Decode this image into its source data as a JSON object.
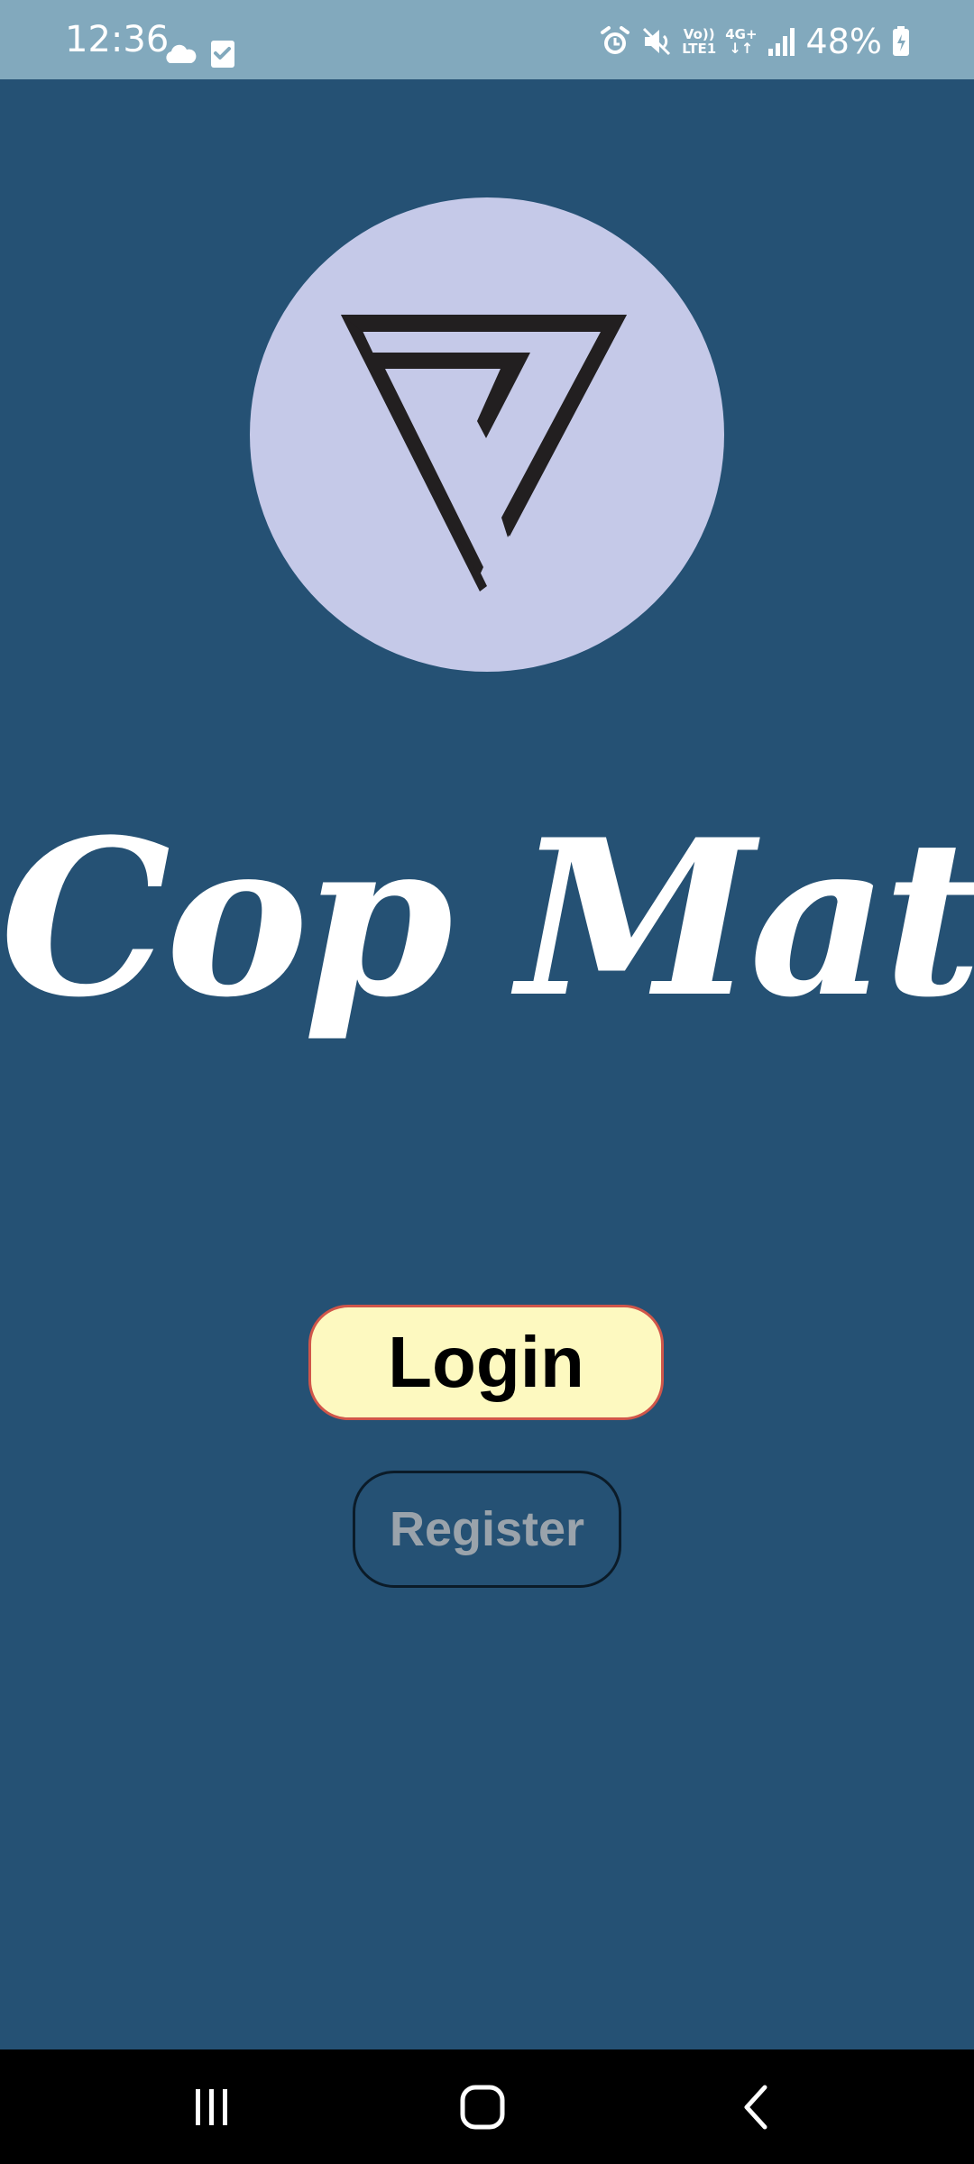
{
  "status_bar": {
    "time": "12:36",
    "network_top": "Vo))",
    "network_bottom": "LTE1",
    "data_top": "4G+",
    "battery": "48%",
    "left_icons": [
      "cloud-icon",
      "checkbox-icon"
    ],
    "right_icons": [
      "alarm-icon",
      "mute-icon",
      "signal-icon",
      "battery-charging-icon"
    ]
  },
  "app": {
    "title": "Cop Mate",
    "logo_icon": "triangle-logo-icon"
  },
  "actions": {
    "login_label": "Login",
    "register_label": "Register"
  },
  "nav_bar": {
    "icons": [
      "recent-apps-icon",
      "home-icon",
      "back-icon"
    ]
  },
  "colors": {
    "background": "#255174",
    "status_bar": "#82a9bd",
    "logo_circle": "#c5c9e8",
    "login_fill": "#fdf9c0",
    "login_border": "#d0564a",
    "register_text": "#9aa3ab"
  }
}
